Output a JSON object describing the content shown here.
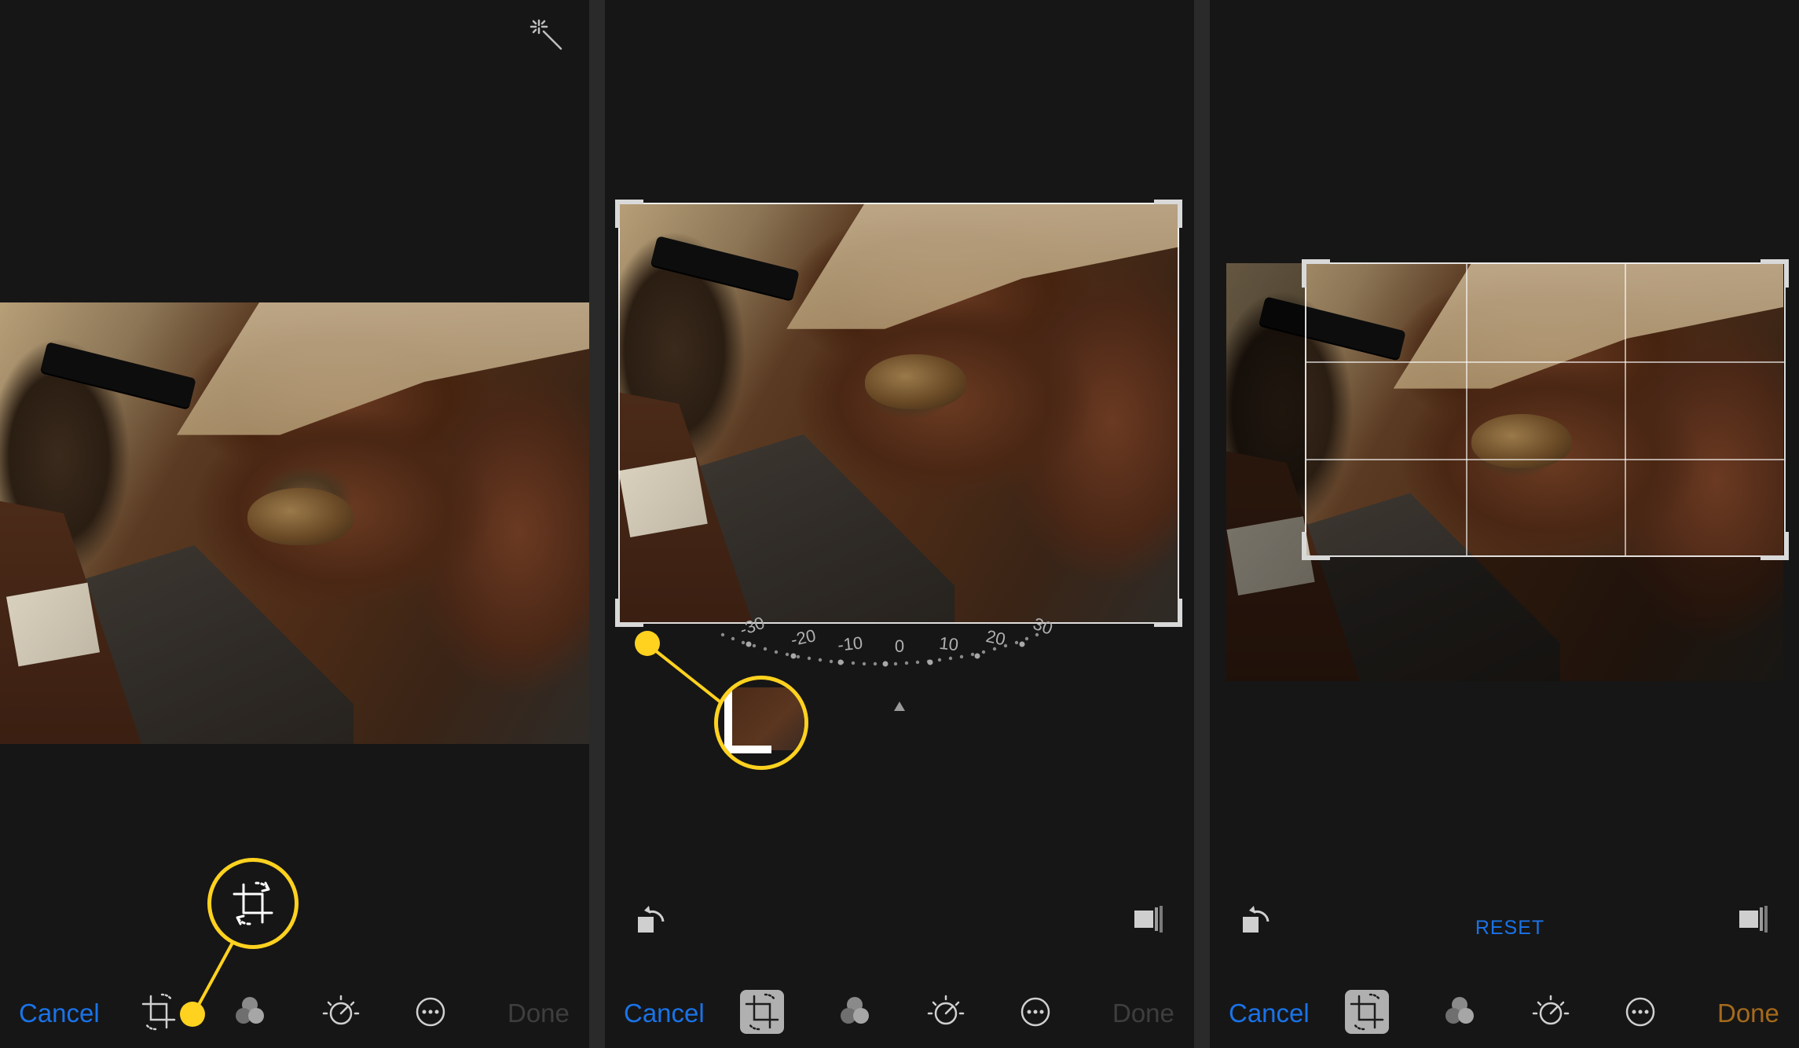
{
  "panels": [
    {
      "toolbar": {
        "cancel_label": "Cancel",
        "done_label": "Done",
        "icons": [
          "crop-rotate-icon",
          "filters-icon",
          "adjust-icon",
          "more-icon"
        ],
        "active": ""
      },
      "top_icon": "magic-wand-icon",
      "callout": "crop-rotate-icon"
    },
    {
      "toolbar": {
        "cancel_label": "Cancel",
        "done_label": "Done",
        "icons": [
          "crop-rotate-icon",
          "filters-icon",
          "adjust-icon",
          "more-icon"
        ],
        "active": "crop-rotate-icon"
      },
      "edit_row": {
        "rotate_icon": "rotate-left-icon",
        "aspect_icon": "aspect-ratio-icon"
      },
      "dial": {
        "labels": [
          "-30",
          "-20",
          "-10",
          "0",
          "10",
          "20",
          "30"
        ]
      },
      "callout": "crop-corner-handle"
    },
    {
      "toolbar": {
        "cancel_label": "Cancel",
        "done_label": "Done",
        "icons": [
          "crop-rotate-icon",
          "filters-icon",
          "adjust-icon",
          "more-icon"
        ],
        "active": "crop-rotate-icon"
      },
      "edit_row": {
        "rotate_icon": "rotate-left-icon",
        "reset_label": "RESET",
        "aspect_icon": "aspect-ratio-icon"
      }
    }
  ],
  "colors": {
    "accent_blue": "#1a73e8",
    "callout_yellow": "#ffd21f",
    "done_enabled": "#a56a1c",
    "done_disabled": "#3e3e3e"
  }
}
